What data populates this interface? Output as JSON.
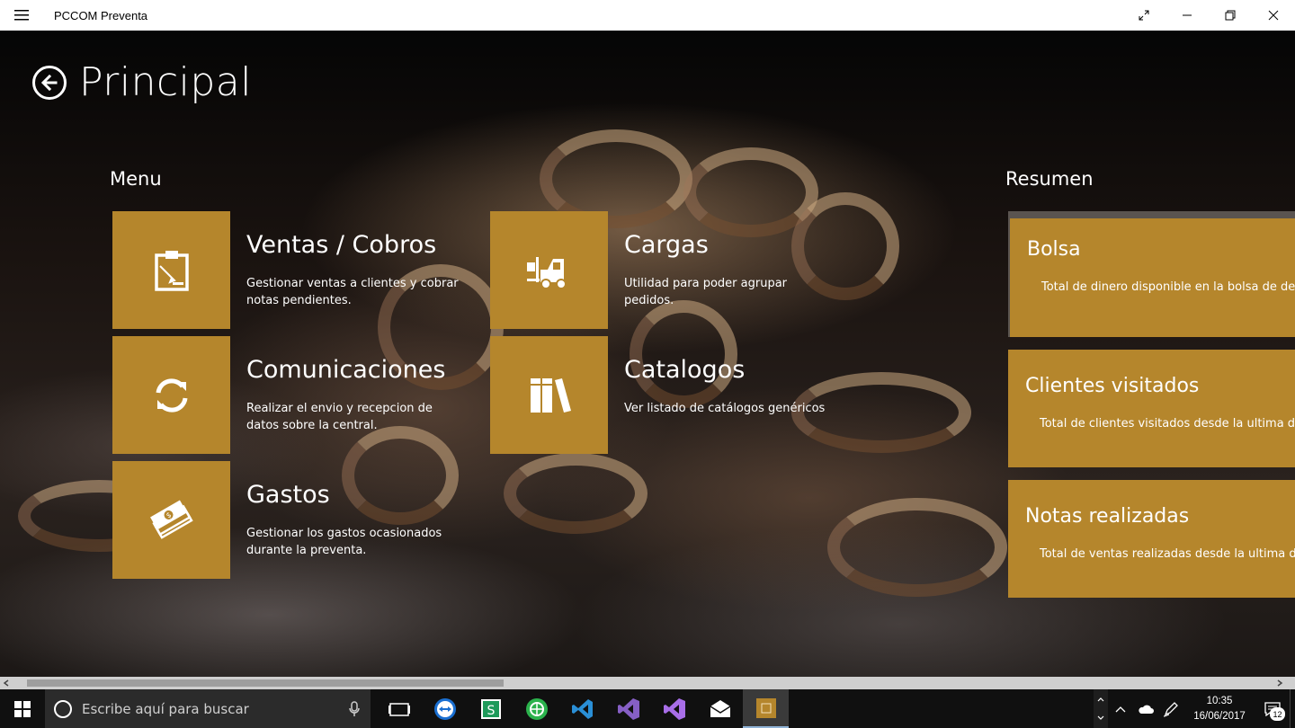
{
  "window": {
    "title": "PCCOM Preventa"
  },
  "header": {
    "title": "Principal"
  },
  "menu": {
    "title": "Menu",
    "items": [
      {
        "title": "Ventas / Cobros",
        "desc": "Gestionar ventas a clientes y cobrar notas pendientes.",
        "icon": "clipboard-edit-icon"
      },
      {
        "title": "Comunicaciones",
        "desc": "Realizar el envio y recepcion de datos sobre la central.",
        "icon": "sync-icon"
      },
      {
        "title": "Gastos",
        "desc": "Gestionar los gastos ocasionados durante la preventa.",
        "icon": "money-icon"
      },
      {
        "title": "Cargas",
        "desc": "Utilidad para poder agrupar pedidos.",
        "icon": "forklift-icon"
      },
      {
        "title": "Catalogos",
        "desc": "Ver listado de catálogos genéricos",
        "icon": "books-icon"
      }
    ]
  },
  "summary": {
    "title": "Resumen",
    "cards": [
      {
        "title": "Bolsa",
        "desc": "Total de dinero disponible en la bolsa de desc"
      },
      {
        "title": "Clientes visitados",
        "desc": "Total de clientes visitados desde la ultima desc"
      },
      {
        "title": "Notas realizadas",
        "desc": "Total de ventas realizadas desde la ultima desc"
      }
    ]
  },
  "taskbar": {
    "search_placeholder": "Escribe aquí para buscar",
    "time": "10:35",
    "date": "16/06/2017",
    "notifications": "12"
  },
  "colors": {
    "tile": "#b5862c",
    "titlebar": "#ffffff",
    "taskbar": "#101010"
  }
}
